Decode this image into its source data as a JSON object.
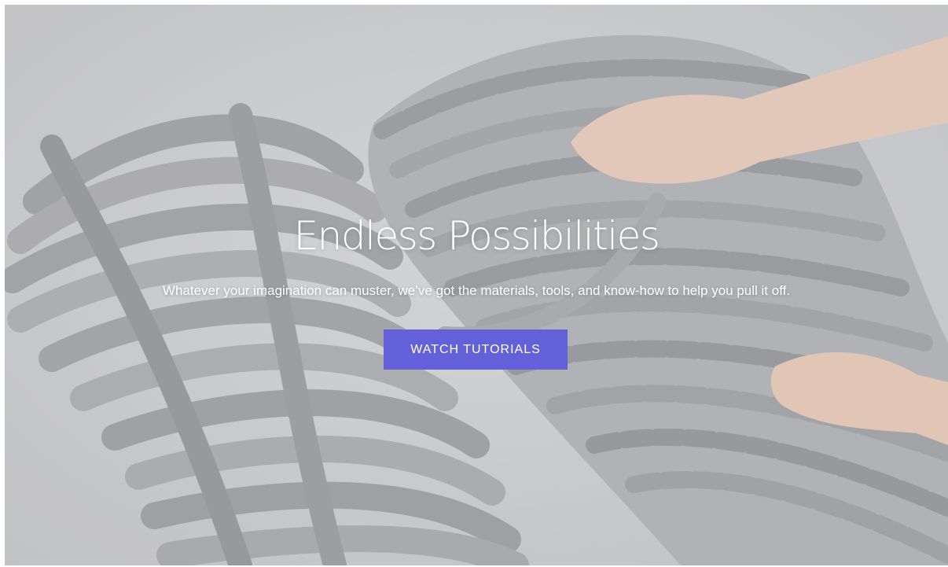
{
  "hero": {
    "title": "Endless Possibilities",
    "subtitle": "Whatever your imagination can muster, we’ve got the materials, tools, and know-how to help you pull it off.",
    "cta_label": "WATCH TUTORIALS"
  },
  "colors": {
    "cta_background": "#6360d9",
    "text": "#ffffff",
    "background": "#d3d4d6"
  },
  "image": {
    "alt": "chunky-knit-yarn-photo"
  }
}
